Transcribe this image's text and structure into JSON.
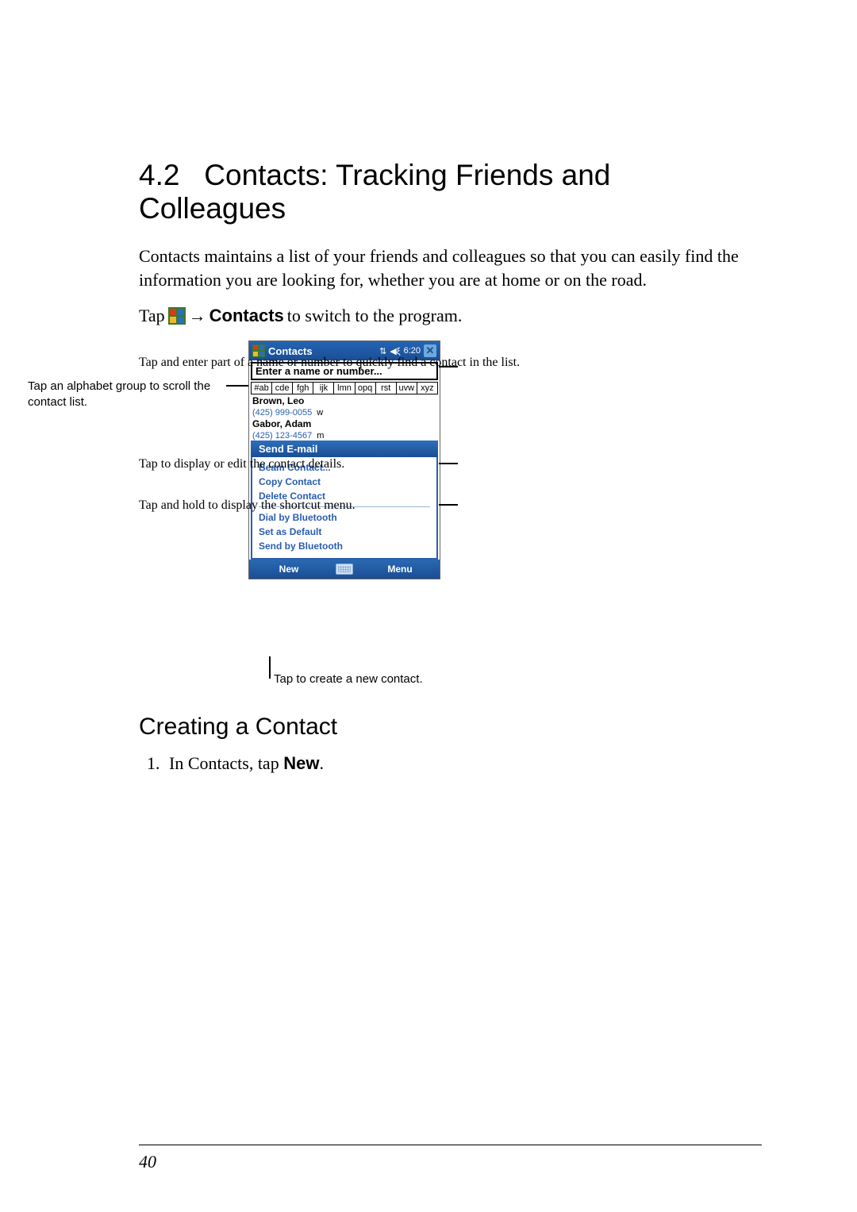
{
  "section": {
    "number": "4.2",
    "title": "Contacts: Tracking Friends and Colleagues"
  },
  "intro": "Contacts maintains a list of your friends and colleagues so that you can easily find the information you are looking for, whether you are at home or on the road.",
  "tap_line": {
    "prefix": "Tap ",
    "arrow": "→",
    "menu": "Contacts",
    "suffix": " to switch to the program."
  },
  "callouts": {
    "left": "Tap an alphabet group to scroll the contact list.",
    "right_top": "Tap and enter part of a name or number to quickly find a contact in the list.",
    "right_mid": "Tap to display or edit the contact details.",
    "right_bottom": "Tap and hold to display the shortcut menu.",
    "bottom": "Tap to create a new contact."
  },
  "device": {
    "title": "Contacts",
    "signal": "◀ξ",
    "time": "6:20",
    "close": "✕",
    "search_placeholder": "Enter a name or number...",
    "alpha_groups": [
      "#ab",
      "cde",
      "fgh",
      "ijk",
      "lmn",
      "opq",
      "rst",
      "uvw",
      "xyz"
    ],
    "contacts": [
      {
        "name": "Brown, Leo",
        "phone": "(425) 999-0055",
        "type": "w"
      },
      {
        "name": "Gabor, Adam",
        "phone": "(425) 123-4567",
        "type": "m"
      }
    ],
    "context_header": "Send E-mail",
    "context_items_a": [
      "Beam Contact...",
      "Copy Contact",
      "Delete Contact"
    ],
    "context_items_b": [
      "Dial by Bluetooth",
      "Set as Default",
      "Send by Bluetooth"
    ],
    "bottom_left": "New",
    "bottom_right": "Menu",
    "antenna_icon": "⇅"
  },
  "subheading": "Creating a Contact",
  "step1": {
    "prefix": "In Contacts, tap ",
    "button": "New",
    "suffix": "."
  },
  "page_number": "40"
}
